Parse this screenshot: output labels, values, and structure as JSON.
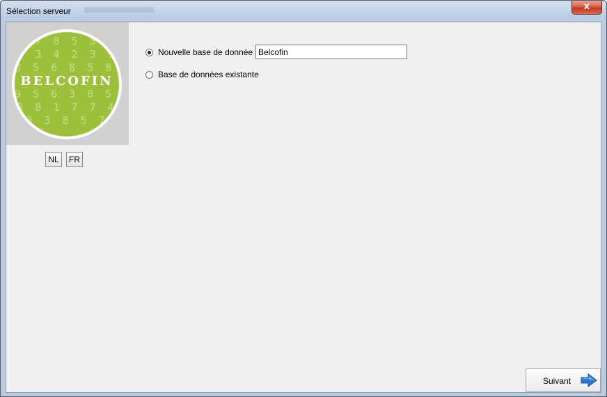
{
  "window": {
    "title": "Sélection serveur",
    "close_glyph": "x"
  },
  "logo": {
    "word": "BELCOFIN",
    "digits": "7 8 5 5\n9 3 4 2 3 9\n8 5 6 8 5 8 1 6\n \n9 5 6 3 8 5 0 4\n8 8 1 7 7 4\n3 3 8 5 7"
  },
  "language": {
    "nl_label": "NL",
    "fr_label": "FR"
  },
  "options": {
    "new_db_label": "Nouvelle base de donnée",
    "new_db_selected": true,
    "existing_db_label": "Base de données existante",
    "existing_db_selected": false
  },
  "db_name_input": {
    "value": "Belcofin"
  },
  "footer": {
    "next_label": "Suivant"
  },
  "colors": {
    "logo_green": "#9dc03c",
    "arrow_blue": "#2f76d2",
    "close_red": "#c2391f"
  }
}
